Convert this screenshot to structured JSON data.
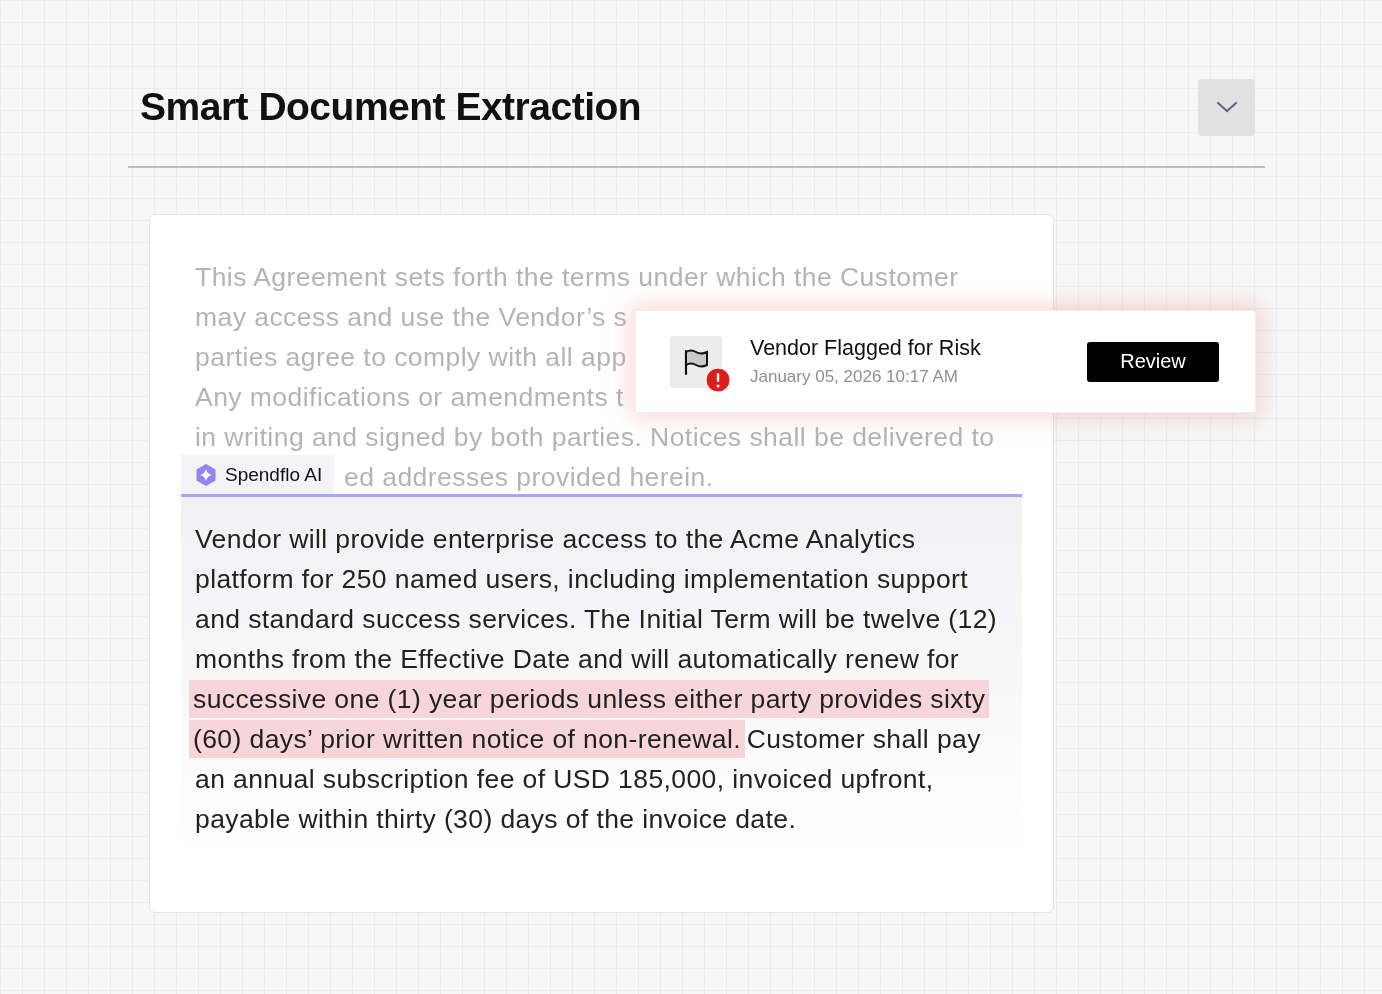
{
  "header": {
    "title": "Smart Document Extraction"
  },
  "document": {
    "faded_lines": [
      "This Agreement sets forth the terms under which the Customer",
      "may access and use the Vendor’s s",
      "parties agree to comply with all app",
      "Any modifications or amendments t",
      "in writing and signed by both parties. Notices shall be delivered to",
      "ed addresses provided herein."
    ],
    "ai_tag": {
      "label": "Spendflo AI"
    },
    "excerpt": [
      {
        "text": "Vendor will provide enterprise access to the Acme Analytics platform for 250 named users, including implementation support and standard success services. The Initial Term will be twelve (12) months from the Effective Date and will automatically renew for ",
        "highlighted": false
      },
      {
        "text": "successive one (1) year periods unless either party provides sixty (60) days’ prior written notice of non-renewal.",
        "highlighted": true
      },
      {
        "text": " Customer shall pay an annual subscription fee of USD 185,000, invoiced upfront, payable within thirty (30) days of the invoice date.",
        "highlighted": false
      }
    ]
  },
  "notification": {
    "title": "Vendor Flagged for Risk",
    "timestamp": "January 05, 2026 10:17 AM",
    "alert": true,
    "button": "Review"
  }
}
